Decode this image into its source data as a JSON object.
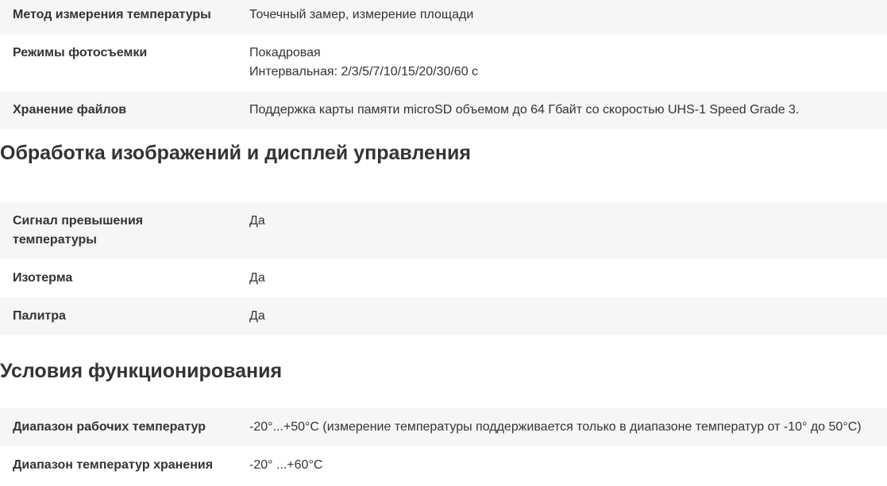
{
  "sections": [
    {
      "title": "",
      "rows": [
        {
          "label": "Метод измерения температуры",
          "value": [
            "Точечный замер, измерение площади"
          ]
        },
        {
          "label": "Режимы фотосъемки",
          "value": [
            "Покадровая",
            "Интервальная: 2/3/5/7/10/15/20/30/60 с"
          ]
        },
        {
          "label": "Хранение файлов",
          "value": [
            "Поддержка карты памяти microSD объемом до 64 Гбайт со скоростью UHS-1 Speed Grade 3."
          ]
        }
      ]
    },
    {
      "title": "Обработка изображений и дисплей управления",
      "rows": [
        {
          "label": "Сигнал превышения температуры",
          "value": [
            "Да"
          ]
        },
        {
          "label": "Изотерма",
          "value": [
            "Да"
          ]
        },
        {
          "label": "Палитра",
          "value": [
            "Да"
          ]
        }
      ]
    },
    {
      "title": "Условия функционирования",
      "rows": [
        {
          "label": "Диапазон рабочих температур",
          "value": [
            "-20°...+50°C (измерение температуры поддерживается только в диапазоне температур от -10° до 50°C)"
          ]
        },
        {
          "label": "Диапазон температур хранения",
          "value": [
            "-20° ...+60°C"
          ]
        }
      ]
    }
  ],
  "colors": {
    "row_shade": "#f6f6f6",
    "text": "#333333",
    "background": "#ffffff"
  }
}
